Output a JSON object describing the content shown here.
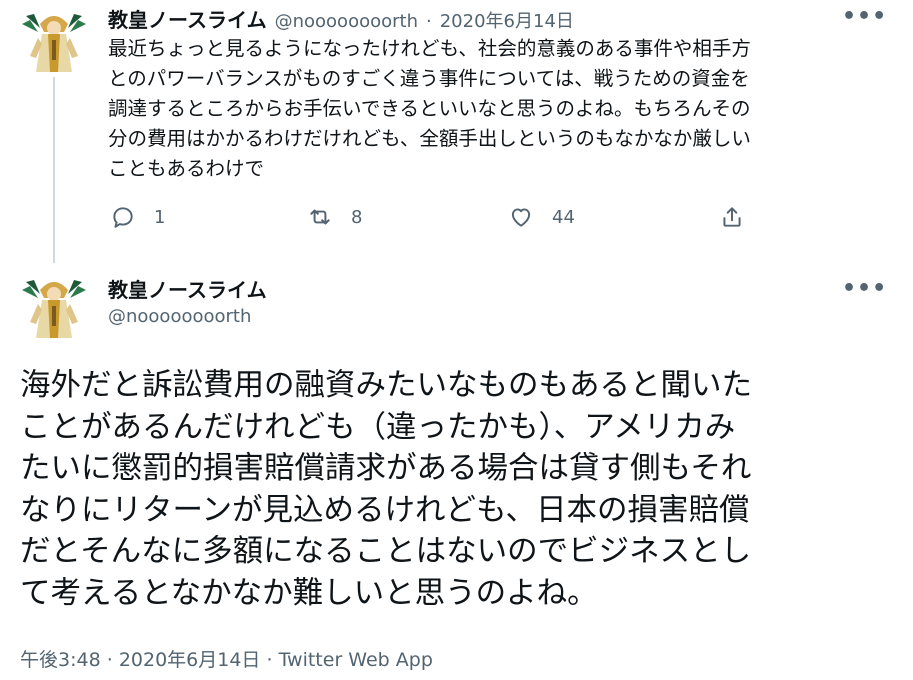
{
  "parent_tweet": {
    "author_name": "教皇ノースライム",
    "author_handle": "@noooooooorth",
    "separator": "·",
    "date": "2020年6月14日",
    "more_icon": "more-horizontal-icon",
    "lines": [
      "最近ちょっと見るようになったけれども、社会的意義のある事件や相手方",
      "とのパワーバランスがものすごく違う事件については、戦うための資金を",
      "調達するところからお手伝いできるといいなと思うのよね。もちろんその",
      "分の費用はかかるわけだけれども、全額手出しというのもなかなか厳しい",
      "こともあるわけで"
    ],
    "actions": {
      "reply_count": "1",
      "retweet_count": "8",
      "like_count": "44"
    }
  },
  "main_tweet": {
    "author_name": "教皇ノースライム",
    "author_handle": "@noooooooorth",
    "more_icon": "more-horizontal-icon",
    "lines": [
      "海外だと訴訟費用の融資みたいなものもあると聞いた",
      "ことがあるんだけれども（違ったかも）、アメリカみ",
      "たいに懲罰的損害賠償請求がある場合は貸す側もそれ",
      "なりにリターンが見込めるけれども、日本の損害賠償",
      "だとそんなに多額になることはないのでビジネスとし",
      "て考えるとなかなか難しいと思うのよね。"
    ],
    "meta": {
      "time": "午後3:48",
      "sep1": "·",
      "date": "2020年6月14日",
      "sep2": "·",
      "source": "Twitter Web App"
    }
  },
  "colors": {
    "text": "#0f1419",
    "secondary": "#536471",
    "thread_line": "#cfd9de"
  }
}
